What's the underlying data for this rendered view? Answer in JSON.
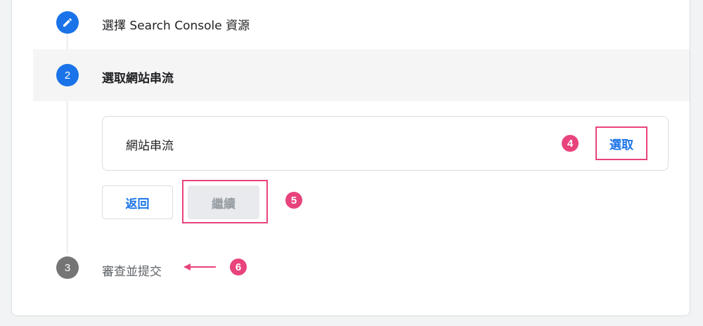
{
  "steps": {
    "step1": {
      "label": "選擇 Search Console 資源",
      "icon": "pencil-icon"
    },
    "step2": {
      "number": "2",
      "label": "選取網站串流"
    },
    "step3": {
      "number": "3",
      "label": "審查並提交"
    }
  },
  "stream_card": {
    "label": "網站串流",
    "select_label": "選取"
  },
  "actions": {
    "back_label": "返回",
    "continue_label": "繼續"
  },
  "annotations": {
    "marker4": "4",
    "marker5": "5",
    "marker6": "6"
  },
  "colors": {
    "accent_blue": "#1a73e8",
    "annotation_pink": "#e8437c",
    "inactive_gray": "#757575",
    "disabled_bg": "#e8eaed"
  }
}
